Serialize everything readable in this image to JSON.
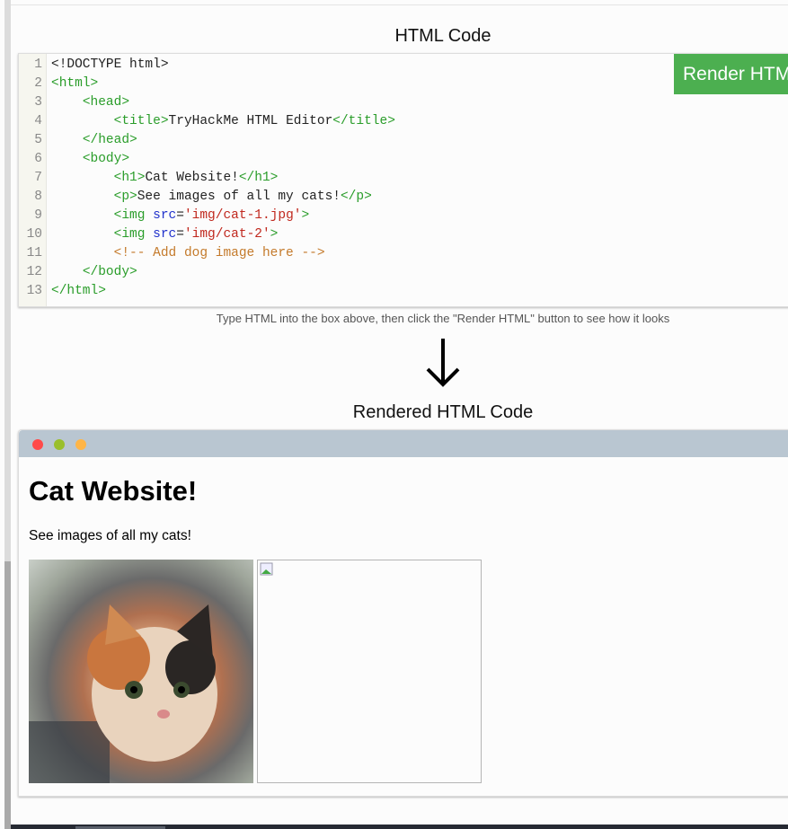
{
  "editor": {
    "heading": "HTML Code",
    "render_button": "Render HTML",
    "lines": [
      [
        [
          "p",
          "<!DOCTYPE html>"
        ]
      ],
      [
        [
          "t",
          "<html>"
        ]
      ],
      [
        [
          "p",
          "    "
        ],
        [
          "t",
          "<head>"
        ]
      ],
      [
        [
          "p",
          "        "
        ],
        [
          "t",
          "<title>"
        ],
        [
          "p",
          "TryHackMe HTML Editor"
        ],
        [
          "t",
          "</title>"
        ]
      ],
      [
        [
          "p",
          "    "
        ],
        [
          "t",
          "</head>"
        ]
      ],
      [
        [
          "p",
          "    "
        ],
        [
          "t",
          "<body>"
        ]
      ],
      [
        [
          "p",
          "        "
        ],
        [
          "t",
          "<h1>"
        ],
        [
          "p",
          "Cat Website!"
        ],
        [
          "t",
          "</h1>"
        ]
      ],
      [
        [
          "p",
          "        "
        ],
        [
          "t",
          "<p>"
        ],
        [
          "p",
          "See images of all my cats!"
        ],
        [
          "t",
          "</p>"
        ]
      ],
      [
        [
          "p",
          "        "
        ],
        [
          "t",
          "<img "
        ],
        [
          "a",
          "src"
        ],
        [
          "p",
          "="
        ],
        [
          "s",
          "'img/cat-1.jpg'"
        ],
        [
          "t",
          ">"
        ]
      ],
      [
        [
          "p",
          "        "
        ],
        [
          "t",
          "<img "
        ],
        [
          "a",
          "src"
        ],
        [
          "p",
          "="
        ],
        [
          "s",
          "'img/cat-2'"
        ],
        [
          "t",
          ">"
        ]
      ],
      [
        [
          "p",
          "        "
        ],
        [
          "c",
          "<!-- Add dog image here -->"
        ]
      ],
      [
        [
          "p",
          "    "
        ],
        [
          "t",
          "</body>"
        ]
      ],
      [
        [
          "t",
          "</html>"
        ]
      ]
    ],
    "hint": "Type HTML into the box above, then click the \"Render HTML\" button to see how it looks"
  },
  "icons": {
    "arrow": "arrow-down-icon"
  },
  "rendered": {
    "heading": "Rendered HTML Code",
    "window_dots": [
      "#ff4a4a",
      "#9abf2c",
      "#ffb547"
    ],
    "h1": "Cat Website!",
    "p": "See images of all my cats!"
  }
}
